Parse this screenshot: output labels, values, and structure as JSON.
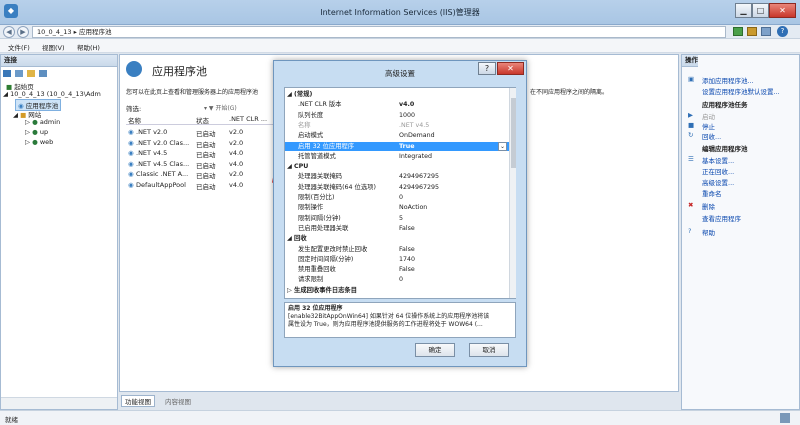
{
  "window": {
    "title": "Internet Information Services (IIS)管理器",
    "min": "▁",
    "max": "□",
    "close": "✕"
  },
  "address": {
    "path": "10_0_4_13  ▸  应用程序池"
  },
  "menu": [
    "文件(F)",
    "视图(V)",
    "帮助(H)"
  ],
  "left": {
    "header": "连接",
    "tree": [
      "起始页",
      "10_0_4_13 (10_0_4_13\\Adm",
      "应用程序池",
      "网站",
      "admin",
      "up",
      "web"
    ]
  },
  "center": {
    "title": "应用程序池",
    "desc": "您可以在此页上查看和管理服务器上的应用程序池",
    "desc_right": "在不同应用程序之间的隔离。",
    "filter_label": "筛选:",
    "start_label": "▾ ▼ 开始(G)",
    "columns": [
      "名称",
      "状态",
      ".NET CLR ..."
    ],
    "rows": [
      {
        "name": ".NET v2.0",
        "status": "已启动",
        "clr": "v2.0"
      },
      {
        "name": ".NET v2.0 Clas...",
        "status": "已启动",
        "clr": "v2.0"
      },
      {
        "name": ".NET v4.5",
        "status": "已启动",
        "clr": "v4.0"
      },
      {
        "name": ".NET v4.5 Clas...",
        "status": "已启动",
        "clr": "v4.0"
      },
      {
        "name": "Classic .NET A...",
        "status": "已启动",
        "clr": "v2.0"
      },
      {
        "name": "DefaultAppPool",
        "status": "已启动",
        "clr": "v4.0"
      }
    ],
    "tabs": [
      "功能视图",
      "内容视图"
    ]
  },
  "right": {
    "header": "操作",
    "items": [
      {
        "text": "添加应用程序池...",
        "style": "link"
      },
      {
        "text": "设置应用程序池默认设置...",
        "style": "link"
      },
      {
        "text": "应用程序池任务",
        "style": "bold"
      },
      {
        "text": "启动",
        "style": "gray"
      },
      {
        "text": "停止",
        "style": "link"
      },
      {
        "text": "回收...",
        "style": "link"
      },
      {
        "text": "编辑应用程序池",
        "style": "bold"
      },
      {
        "text": "基本设置...",
        "style": "link"
      },
      {
        "text": "正在回收...",
        "style": "link"
      },
      {
        "text": "高级设置...",
        "style": "link"
      },
      {
        "text": "重命名",
        "style": "link"
      },
      {
        "text": "删除",
        "style": "link"
      },
      {
        "text": "查看应用程序",
        "style": "link"
      },
      {
        "text": "帮助",
        "style": "link"
      }
    ]
  },
  "dialog": {
    "title": "高级设置",
    "help": "?",
    "close": "✕",
    "properties": [
      {
        "key": "(常规)",
        "value": "",
        "type": "cat"
      },
      {
        "key": ".NET CLR 版本",
        "value": "v4.0",
        "type": "bold"
      },
      {
        "key": "队列长度",
        "value": "1000",
        "type": ""
      },
      {
        "key": "名称",
        "value": ".NET v4.5",
        "type": "gray"
      },
      {
        "key": "启动模式",
        "value": "OnDemand",
        "type": ""
      },
      {
        "key": "启用 32 位应用程序",
        "value": "True",
        "type": "sel"
      },
      {
        "key": "托管管道模式",
        "value": "Integrated",
        "type": ""
      },
      {
        "key": "CPU",
        "value": "",
        "type": "cat"
      },
      {
        "key": "处理器关联掩码",
        "value": "4294967295",
        "type": ""
      },
      {
        "key": "处理器关联掩码(64 位选项)",
        "value": "4294967295",
        "type": ""
      },
      {
        "key": "限制(百分比)",
        "value": "0",
        "type": ""
      },
      {
        "key": "限制操作",
        "value": "NoAction",
        "type": ""
      },
      {
        "key": "限制间隔(分钟)",
        "value": "5",
        "type": ""
      },
      {
        "key": "已启用处理器关联",
        "value": "False",
        "type": ""
      },
      {
        "key": "回收",
        "value": "",
        "type": "cat"
      },
      {
        "key": "发生配置更改时禁止回收",
        "value": "False",
        "type": ""
      },
      {
        "key": "固定时间间隔(分钟)",
        "value": "1740",
        "type": ""
      },
      {
        "key": "禁用重叠回收",
        "value": "False",
        "type": ""
      },
      {
        "key": "请求限制",
        "value": "0",
        "type": ""
      },
      {
        "key": "生成回收事件日志条目",
        "value": "",
        "type": "cat2"
      }
    ],
    "desc_title": "启用 32 位应用程序",
    "desc_line1": "[enable32BitAppOnWin64] 如果针对 64 位操作系统上的应用程序池将该",
    "desc_line2": "属性设为 True，则为应用程序池提供服务的工作进程将处于 WOW64 (...",
    "ok": "确定",
    "cancel": "取消"
  },
  "status": {
    "text": "就绪"
  }
}
